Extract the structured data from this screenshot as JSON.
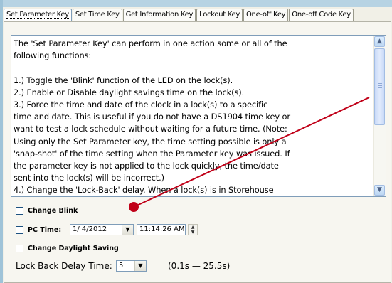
{
  "tabs": [
    {
      "label": "Set Parameter Key",
      "active": true
    },
    {
      "label": "Set Time Key",
      "active": false
    },
    {
      "label": "Get Information Key",
      "active": false
    },
    {
      "label": "Lockout Key",
      "active": false
    },
    {
      "label": "One-off Key",
      "active": false
    },
    {
      "label": "One-off Code Key",
      "active": false
    }
  ],
  "description": {
    "text": "The 'Set Parameter Key' can perform in one action some or all of the\nfollowing functions:\n\n1.) Toggle the 'Blink' function of the LED on the lock(s).\n2.) Enable or Disable daylight savings time on the lock(s).\n3.) Force the time and date of the clock in a lock(s) to a specific\ntime and date. This is useful if you do not have a DS1904 time key or\nwant to test a lock schedule without waiting for a future time. (Note:\nUsing only the Set Parameter key, the time setting possible is only a\n'snap-shot' of the time setting when the Parameter key was issued. If\nthe parameter key is not applied to the lock quickly, the time/date\nsent into the lock(s) will be incorrect.)\n4.) Change the 'Lock-Back' delay. When a lock(s) is in Storehouse"
  },
  "options": {
    "change_blink_label": "Change Blink",
    "pc_time_label": "PC Time:",
    "date_value": "1/ 4/2012",
    "time_value": "11:14:26 AM",
    "daylight_label": "Change Daylight Saving",
    "delay_label": "Lock Back Delay Time:",
    "delay_value": "5",
    "delay_range": "(0.1s — 25.5s)"
  },
  "colors": {
    "annotation": "#c00018",
    "accent": "#7f9db9"
  }
}
